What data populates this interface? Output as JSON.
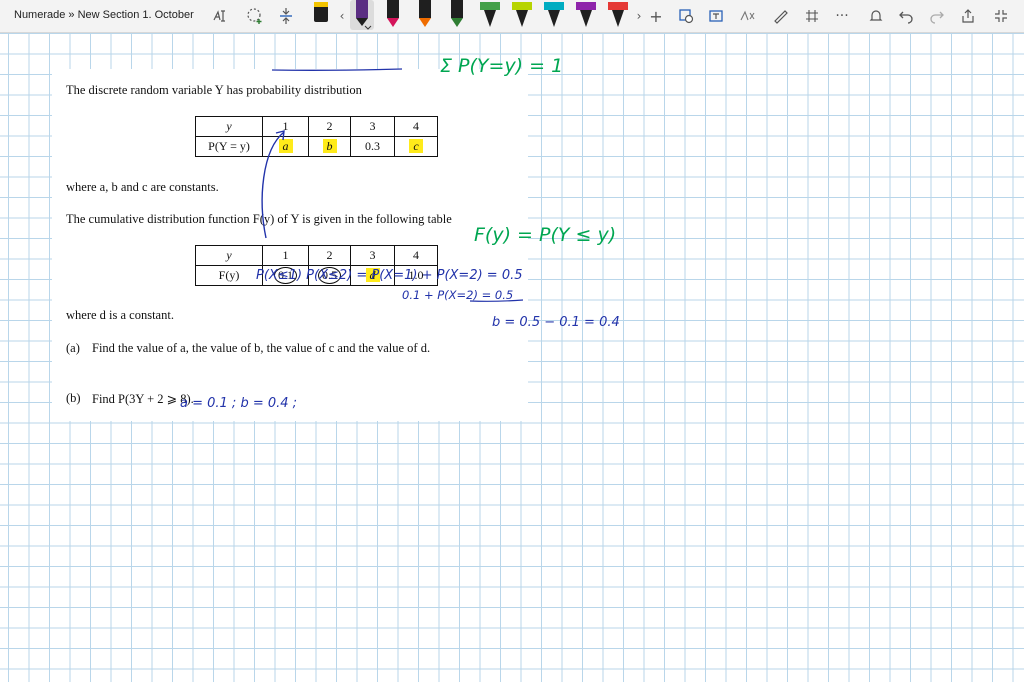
{
  "toolbar": {
    "breadcrumb": "Numerade » New Section 1. October",
    "more_label": "···",
    "pen_colors": [
      "#1f1f1f",
      "#5a2d82",
      "#d4145a",
      "#ef6c00",
      "#2e7d32",
      "#43a047",
      "#b7d400",
      "#ffd600",
      "#00acc1",
      "#1e88e5",
      "#8e24aa",
      "#e53935"
    ]
  },
  "question": {
    "intro": "The discrete random variable Y has probability distribution",
    "table1": {
      "header": [
        "y",
        "1",
        "2",
        "3",
        "4"
      ],
      "row_label": "P(Y = y)",
      "values": [
        "a",
        "b",
        "0.3",
        "c"
      ]
    },
    "constants_note": "where a, b and c are constants.",
    "cdf_intro": "The cumulative distribution function F(y) of Y is given in the following table",
    "table2": {
      "header": [
        "y",
        "1",
        "2",
        "3",
        "4"
      ],
      "row_label": "F(y)",
      "values": [
        "0.1",
        "0.5",
        "d",
        "1.0"
      ]
    },
    "d_note": "where d is a constant.",
    "part_a_label": "(a)",
    "part_a": "Find the value of a, the value of b, the value of c and the value of d.",
    "part_b_label": "(b)",
    "part_b": "Find P(3Y + 2 ⩾ 8)."
  },
  "handwriting": {
    "sum_rule": "Σ P(Y=y) = 1",
    "cdf_def": "F(y) = P(Y ≤ y)",
    "line1": "P(X≤1)  P(X≤2) = P(X=1) + P(X=2) = 0.5",
    "line2": "0.1  +  P(X=2) = 0.5",
    "line3": "b = 0.5 − 0.1 = 0.4",
    "answer": "a = 0.1 ;  b = 0.4 ;",
    "ink_color": "#00a651",
    "blue_ink": "#2233aa"
  }
}
